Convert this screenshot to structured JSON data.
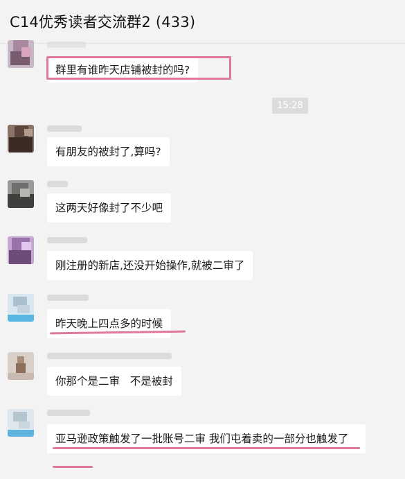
{
  "window": {
    "title": "C14优秀读者交流群2 (433)"
  },
  "timestamp": "15:28",
  "messages": [
    {
      "text": "群里有谁昨天店铺被封的吗?"
    },
    {
      "text": "有朋友的被封了,算吗?"
    },
    {
      "text": "这两天好像封了不少吧"
    },
    {
      "text": "刚注册的新店,还没开始操作,就被二审了"
    },
    {
      "text": "昨天晚上四点多的时候"
    },
    {
      "text": "你那个是二审   不是被封"
    },
    {
      "text": "亚马逊政策触发了一批账号二审 我们屯着卖的一部分也触发了"
    }
  ],
  "colors": {
    "highlight": "#e0779e",
    "bubble": "#ffffff",
    "background": "#f3f3f3"
  }
}
